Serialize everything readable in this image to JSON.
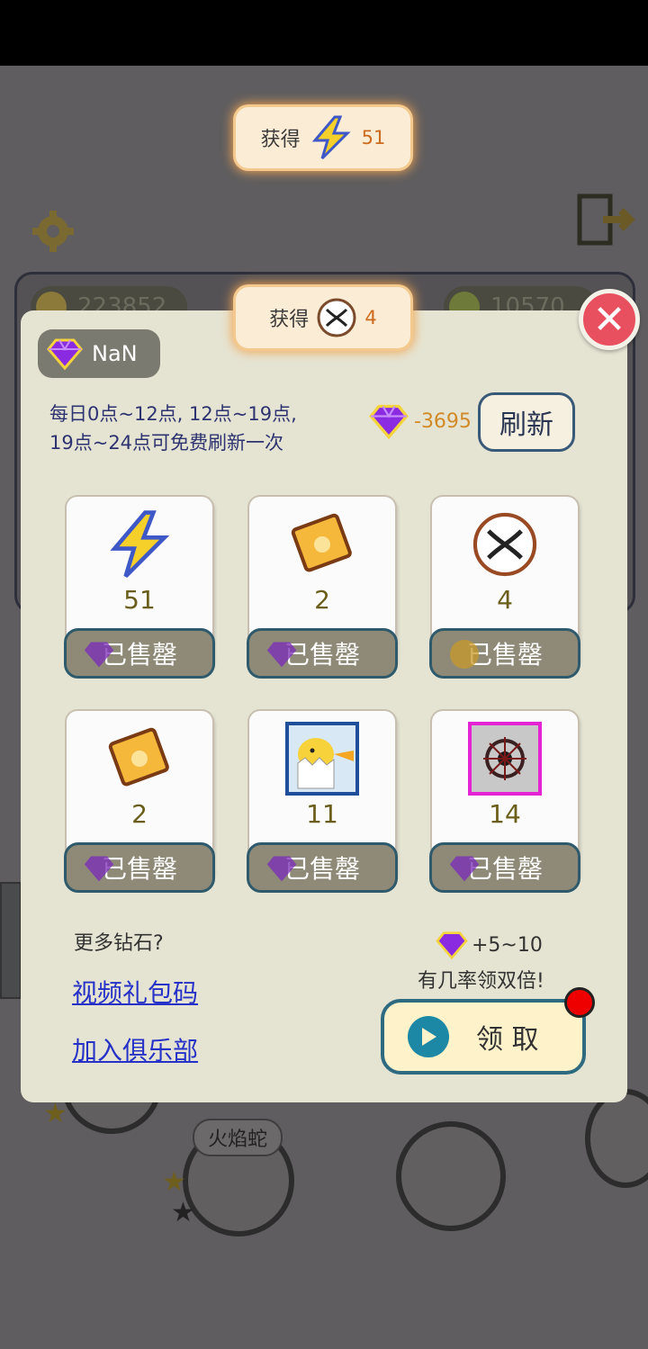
{
  "toasts": [
    {
      "label": "获得",
      "value": "51",
      "icon": "lightning-icon"
    },
    {
      "label": "获得",
      "value": "4",
      "icon": "dna-icon"
    }
  ],
  "background": {
    "coins": "223852",
    "energy": "10570",
    "pet_name": "火焰蛇"
  },
  "dialog": {
    "gem_balance": "NaN",
    "info_line1": "每日0点~12点, 12点~19点,",
    "info_line2": "19点~24点可免费刷新一次",
    "refresh_cost": "-3695",
    "refresh_label": "刷新",
    "close_label": "✕",
    "items": [
      {
        "qty": "51",
        "icon": "lightning-icon",
        "sold": "已售罄"
      },
      {
        "qty": "2",
        "icon": "food-packet-icon",
        "sold": "已售罄"
      },
      {
        "qty": "4",
        "icon": "dna-icon",
        "sold": "已售罄"
      },
      {
        "qty": "2",
        "icon": "food-packet-icon",
        "sold": "已售罄"
      },
      {
        "qty": "11",
        "icon": "chick-skill-icon",
        "sold": "已售罄"
      },
      {
        "qty": "14",
        "icon": "web-skill-icon",
        "sold": "已售罄"
      }
    ],
    "more_gems": "更多钻石?",
    "link_video": "视频礼包码",
    "link_club": "加入俱乐部",
    "reward_amount": "+5~10",
    "reward_note": "有几率领双倍!",
    "claim_label": "领 取"
  },
  "colors": {
    "accent": "#2e6a80",
    "gem": "#8a2be2",
    "link": "#2631c7",
    "close": "#e85060"
  }
}
